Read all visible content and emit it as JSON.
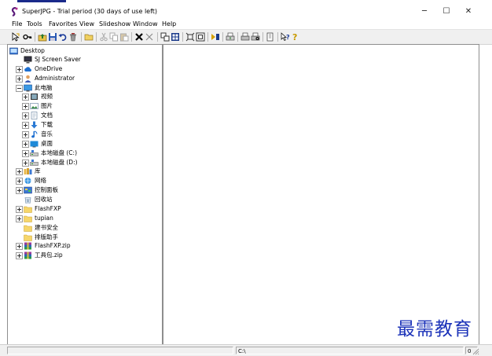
{
  "window": {
    "title": "SuperJPG - Trial period (30 days of use left)",
    "controls": {
      "minimize": "─",
      "maximize": "☐",
      "close": "✕"
    }
  },
  "menu": [
    "File",
    "Tools",
    "Favorites",
    "View",
    "Slideshow",
    "Window",
    "Help"
  ],
  "toolbar": {
    "icons": [
      "cursor-icon",
      "key-icon",
      "folder-up-icon",
      "save-icon",
      "undo-icon",
      "recycle-icon",
      "open-folder-icon",
      "cut-icon",
      "copy-icon",
      "paste-icon",
      "delete-icon",
      "close-icon",
      "thumbnails-icon",
      "grid-view-icon",
      "fit-window-icon",
      "full-screen-icon",
      "slideshow-icon",
      "print-setup-icon",
      "print-icon",
      "print-preview-icon",
      "help-icon",
      "context-help-icon",
      "tip-icon"
    ]
  },
  "tree": {
    "items": [
      {
        "label": "Desktop",
        "icon": "desktop-icon",
        "expander": "none"
      },
      {
        "label": "SJ Screen Saver",
        "icon": "monitor-icon",
        "expander": "none"
      },
      {
        "label": "OneDrive",
        "icon": "cloud-icon",
        "expander": "collapsed"
      },
      {
        "label": "Administrator",
        "icon": "user-icon",
        "expander": "collapsed"
      },
      {
        "label": "此电脑",
        "icon": "computer-icon",
        "expander": "expanded"
      },
      {
        "label": "视频",
        "icon": "video-icon",
        "expander": "collapsed"
      },
      {
        "label": "图片",
        "icon": "pictures-icon",
        "expander": "collapsed"
      },
      {
        "label": "文档",
        "icon": "document-icon",
        "expander": "collapsed"
      },
      {
        "label": "下载",
        "icon": "download-icon",
        "expander": "collapsed"
      },
      {
        "label": "音乐",
        "icon": "music-icon",
        "expander": "collapsed"
      },
      {
        "label": "桌面",
        "icon": "desktop-folder-icon",
        "expander": "collapsed"
      },
      {
        "label": "本地磁盘 (C:)",
        "icon": "drive-icon",
        "expander": "collapsed"
      },
      {
        "label": "本地磁盘 (D:)",
        "icon": "drive-icon",
        "expander": "collapsed"
      },
      {
        "label": "库",
        "icon": "library-icon",
        "expander": "collapsed"
      },
      {
        "label": "网络",
        "icon": "network-icon",
        "expander": "collapsed"
      },
      {
        "label": "控制面板",
        "icon": "control-panel-icon",
        "expander": "collapsed"
      },
      {
        "label": "回收站",
        "icon": "recycle-bin-icon",
        "expander": "none"
      },
      {
        "label": "FlashFXP",
        "icon": "folder-icon",
        "expander": "collapsed"
      },
      {
        "label": "tupian",
        "icon": "folder-icon",
        "expander": "collapsed"
      },
      {
        "label": "建书安全",
        "icon": "folder-icon",
        "expander": "none"
      },
      {
        "label": "排版助手",
        "icon": "folder-icon",
        "expander": "none"
      },
      {
        "label": "FlashFXP.zip",
        "icon": "archive-icon",
        "expander": "collapsed"
      },
      {
        "label": "工具包.zip",
        "icon": "archive-icon",
        "expander": "collapsed"
      }
    ]
  },
  "status": {
    "path": "C:\\",
    "count": "0"
  },
  "watermark": "最需教育"
}
